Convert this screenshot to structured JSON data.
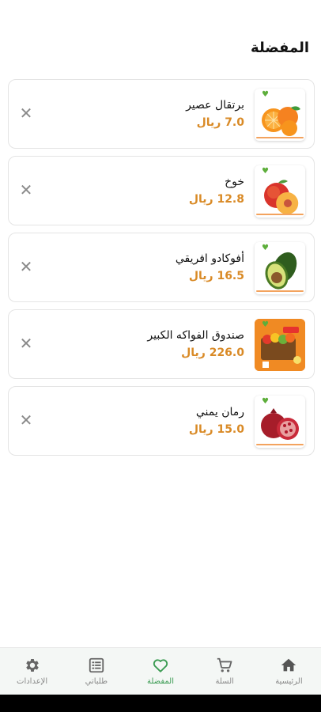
{
  "header": {
    "title": "المفضلة"
  },
  "favorites": [
    {
      "name": "برتقال عصير",
      "price": "7.0 ريال",
      "image": "orange"
    },
    {
      "name": "خوخ",
      "price": "12.8 ريال",
      "image": "peach"
    },
    {
      "name": "أفوكادو افريقي",
      "price": "16.5 ريال",
      "image": "avocado"
    },
    {
      "name": "صندوق الفواكه الكبير",
      "price": "226.0 ريال",
      "image": "fruit-box"
    },
    {
      "name": "رمان يمني",
      "price": "15.0 ريال",
      "image": "pomegranate"
    }
  ],
  "bottom_nav": {
    "items": [
      {
        "label": "الإعدادات",
        "icon": "gear-icon"
      },
      {
        "label": "طلباتي",
        "icon": "orders-icon"
      },
      {
        "label": "المفضلة",
        "icon": "heart-icon",
        "active": true
      },
      {
        "label": "السلة",
        "icon": "cart-icon"
      },
      {
        "label": "الرئيسية",
        "icon": "home-icon"
      }
    ]
  },
  "colors": {
    "accent": "#3a9b52",
    "price": "#d98a26",
    "inactive": "#8a8a8a"
  }
}
